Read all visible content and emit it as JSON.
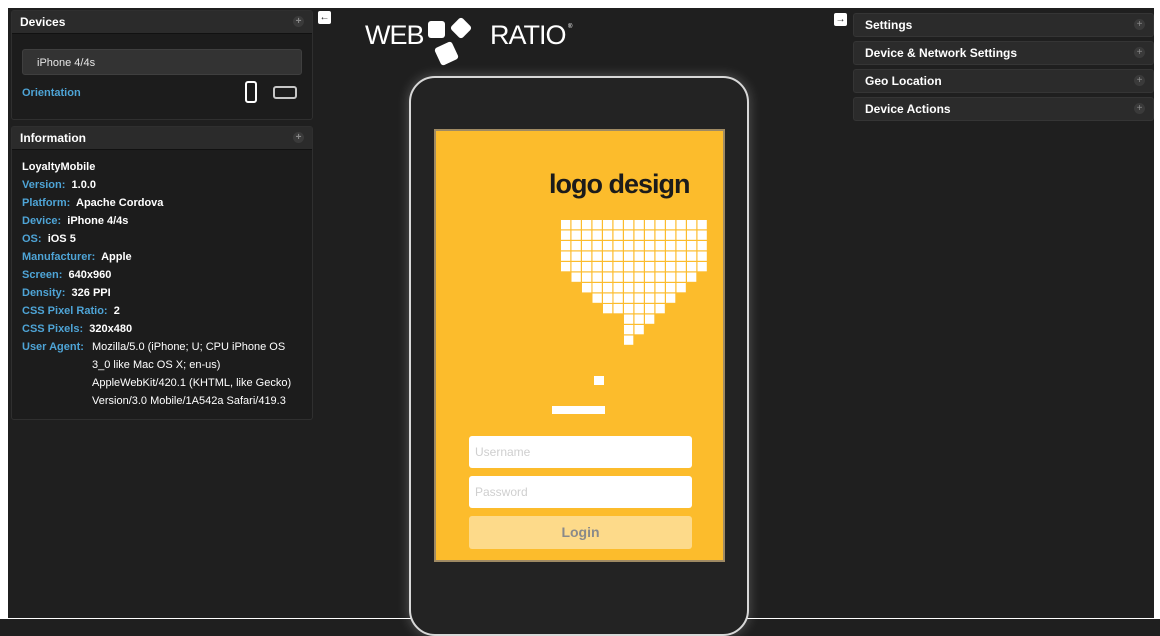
{
  "devices_panel": {
    "title": "Devices",
    "selected_device": "iPhone 4/4s",
    "orientation_label": "Orientation"
  },
  "info_panel": {
    "title": "Information",
    "app_name": "LoyaltyMobile",
    "rows": [
      {
        "key": "Version:",
        "value": "1.0.0"
      },
      {
        "key": "Platform:",
        "value": "Apache Cordova"
      },
      {
        "key": "Device:",
        "value": "iPhone 4/4s"
      },
      {
        "key": "OS:",
        "value": "iOS 5"
      },
      {
        "key": "Manufacturer:",
        "value": "Apple"
      },
      {
        "key": "Screen:",
        "value": "640x960"
      },
      {
        "key": "Density:",
        "value": "326 PPI"
      },
      {
        "key": "CSS Pixel Ratio:",
        "value": "2"
      },
      {
        "key": "CSS Pixels:",
        "value": "320x480"
      }
    ],
    "user_agent_key": "User Agent:",
    "user_agent_value": "Mozilla/5.0 (iPhone; U; CPU iPhone OS 3_0 like Mac OS X; en-us) AppleWebKit/420.1 (KHTML, like Gecko) Version/3.0 Mobile/1A542a Safari/419.3"
  },
  "toggles": {
    "left_arrow": "←",
    "right_arrow": "→",
    "plus": "+"
  },
  "logo": {
    "left": "WEB",
    "right": "RATIO",
    "reg": "®"
  },
  "app_screen": {
    "logo_text": "logo design",
    "username_placeholder": "Username",
    "password_placeholder": "Password",
    "login_label": "Login"
  },
  "right_panels": [
    "Settings",
    "Device & Network Settings",
    "Geo Location",
    "Device Actions"
  ],
  "colors": {
    "accent": "#4ea4d6",
    "app_bg": "#fcbc2c",
    "login_btn": "#fdda8a"
  }
}
